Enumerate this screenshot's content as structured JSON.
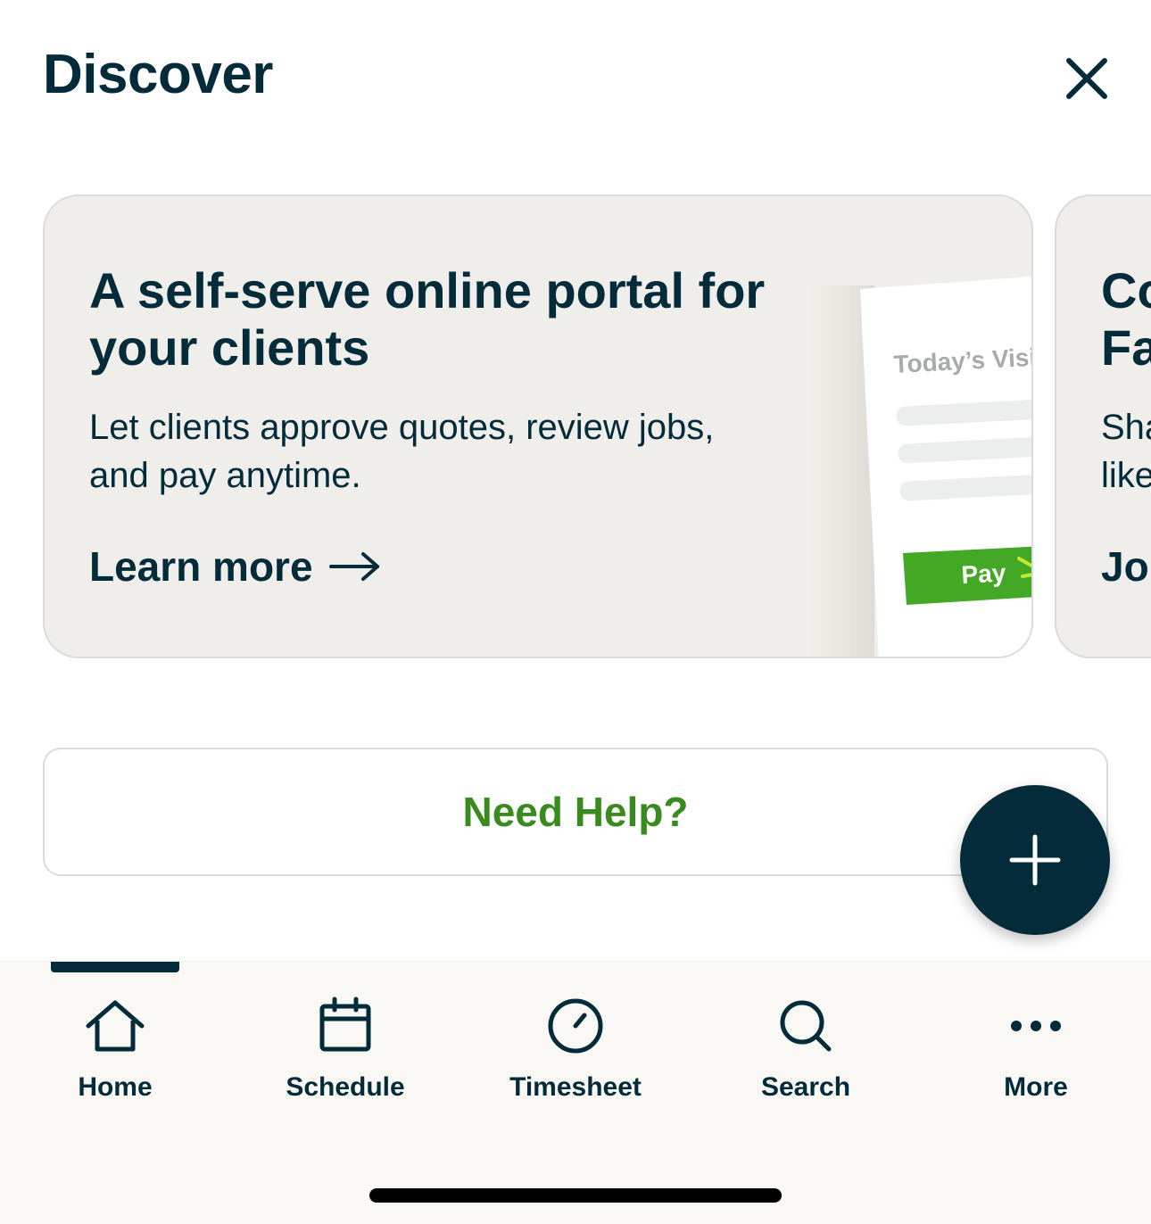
{
  "header": {
    "title": "Discover",
    "close_icon": "close-icon"
  },
  "cards": [
    {
      "title": "A self-serve online portal for your clients",
      "description": "Let clients approve quotes, review jobs, and pay anytime.",
      "link_label": "Learn more",
      "illustration": {
        "heading": "Today’s Visit",
        "button_label": "Pay"
      }
    },
    {
      "title": "Co\nFa",
      "description": "Sha\nlike",
      "link_label": "Jo"
    }
  ],
  "help": {
    "label": "Need Help?"
  },
  "fab": {
    "icon": "plus-icon"
  },
  "tabs": [
    {
      "label": "Home",
      "icon": "home-icon",
      "active": true
    },
    {
      "label": "Schedule",
      "icon": "calendar-icon"
    },
    {
      "label": "Timesheet",
      "icon": "clock-icon"
    },
    {
      "label": "Search",
      "icon": "search-icon"
    },
    {
      "label": "More",
      "icon": "more-icon"
    }
  ],
  "colors": {
    "primary": "#032B3A",
    "accent_green": "#3a8b1e",
    "pay_green": "#44a827",
    "card_bg": "#efeeea"
  }
}
